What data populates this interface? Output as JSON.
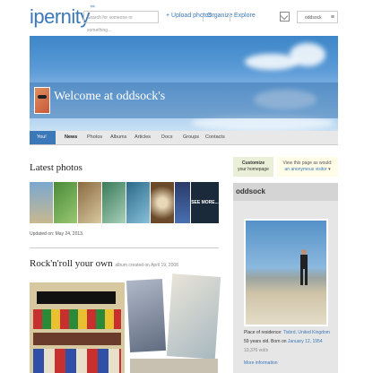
{
  "header": {
    "logo": "ipernity",
    "logo_tm": "™",
    "search_placeholder": "Search for someone or something...",
    "nav": [
      "+ Upload photos",
      "Organize",
      "Explore"
    ],
    "user": "oddsock",
    "menu_glyph": "≡"
  },
  "banner": {
    "welcome": "Welcome at oddsock's"
  },
  "tabs": [
    "You!",
    "News",
    "Photos",
    "Albums",
    "Articles",
    "Docs",
    "Groups",
    "Contacts"
  ],
  "latest": {
    "title": "Latest photos",
    "see_more": "SEE MORE...",
    "updated": "Updated on: May 24, 2013."
  },
  "album": {
    "title": "Rock'n'roll your own",
    "subtitle": "album created on April 19, 2008"
  },
  "sidebar": {
    "customize_line1": "Customize",
    "customize_line2": "your homepage",
    "viewas_line1": "View this page as would:",
    "viewas_line2": "an anonymous visitor",
    "viewas_glyph": "▾",
    "profile_name": "oddsock",
    "residence_label": "Place of residence:",
    "residence_value": "Tisbrd, United Kingdom",
    "age_text": "59 years old. Born on",
    "birth_date": "January 12, 1954",
    "tags": "10,376 vol/s",
    "more_info": "More information"
  },
  "colors": {
    "accent": "#3a78b8",
    "banner_sky": "#5a9ad6"
  }
}
